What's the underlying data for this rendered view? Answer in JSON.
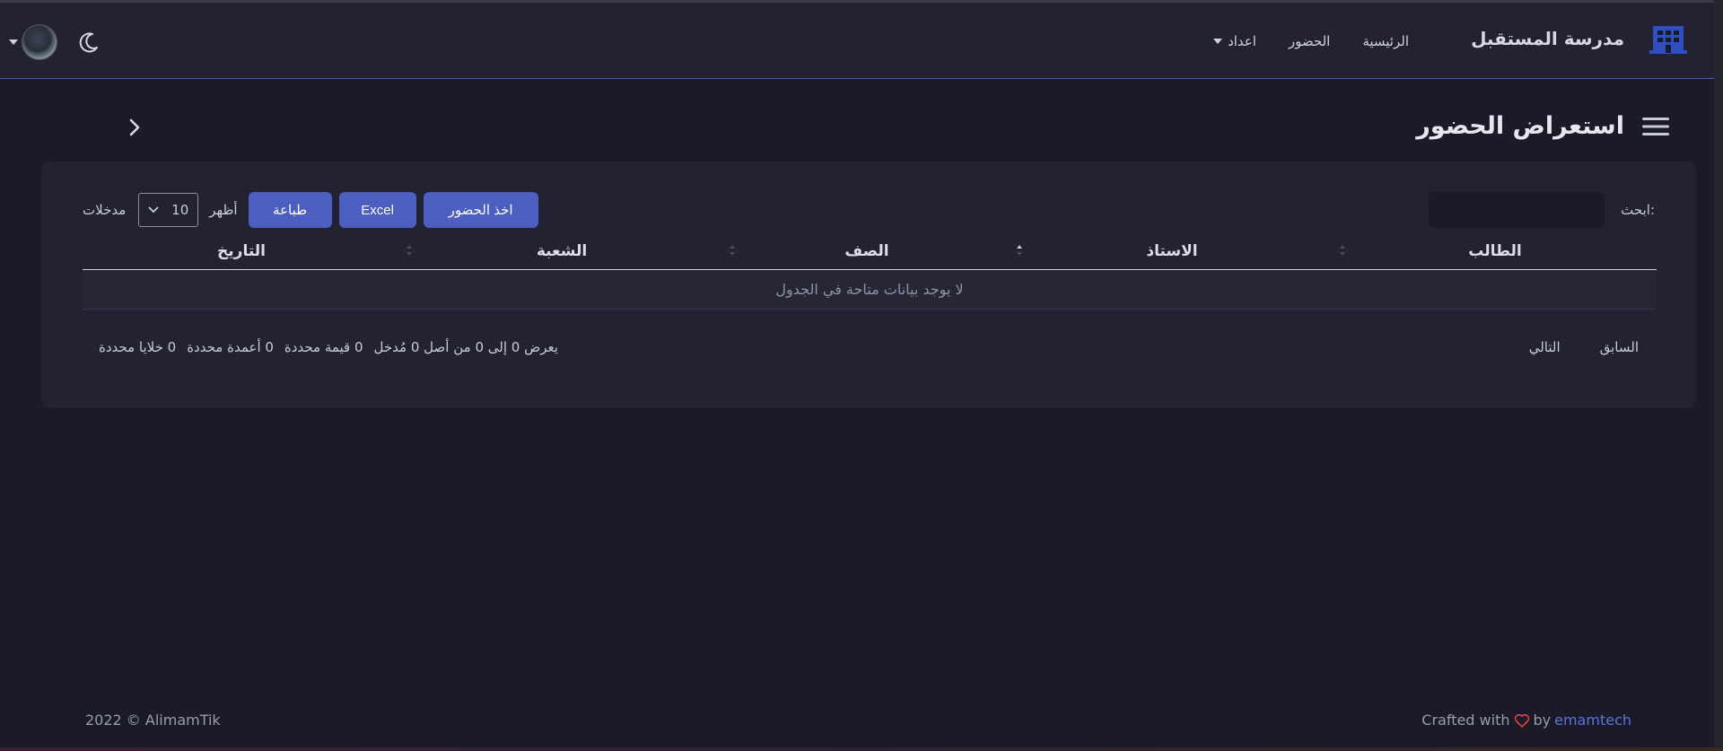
{
  "header": {
    "brand_name": "مدرسة المستقبل",
    "nav": [
      {
        "label": "الرئيسية"
      },
      {
        "label": "الحضور"
      },
      {
        "label": "اعداد"
      }
    ]
  },
  "page": {
    "title": "استعراض الحضور"
  },
  "table": {
    "search_label": "ابحث:",
    "search_value": "",
    "show_label": "أظهر",
    "page_length": "10",
    "entries_label": "مدخلات",
    "buttons": {
      "take_attendance": "اخذ الحضور",
      "excel": "Excel",
      "print": "طباعة"
    },
    "columns": [
      "الطالب",
      "الاستاذ",
      "الصف",
      "الشعبة",
      "التاريخ"
    ],
    "rows": [],
    "empty_text": "لا يوجد بيانات متاحة في الجدول",
    "info_text": "يعرض 0 إلى 0 من أصل 0 مُدخل",
    "selection": {
      "values": "0 قيمة محددة",
      "columns": "0 أعمدة محددة",
      "cells": "0 خلايا محددة"
    },
    "pager": {
      "previous": "السابق",
      "next": "التالي"
    }
  },
  "footer": {
    "copyright": "2022 © AlimamTik",
    "crafted_prefix": "Crafted with",
    "crafted_by": "by",
    "crafted_link": "emamtech"
  },
  "colors": {
    "accent": "#4c5ec0",
    "background": "#1a1a28",
    "surface": "#222232",
    "link": "#5f73d6",
    "heart": "#e0404a"
  }
}
